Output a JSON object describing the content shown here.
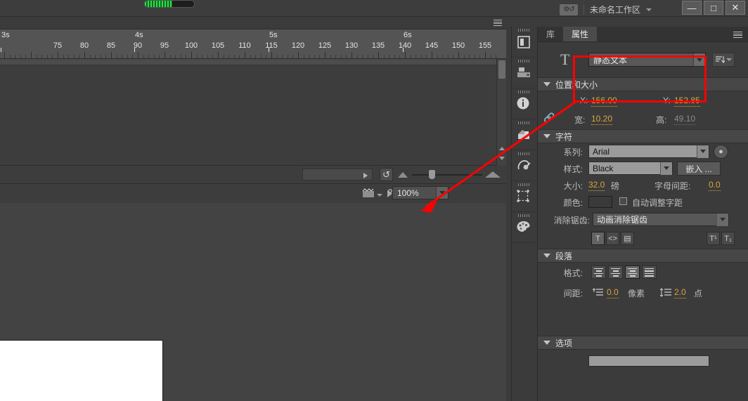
{
  "titlebar": {
    "workspace_name": "未命名工作区",
    "workspace_icon": "workspace-switch-icon",
    "minimize": "—",
    "maximize": "□",
    "close": "✕"
  },
  "timeline": {
    "panel_menu_icon": "panel-menu-icon",
    "second_labels": [
      "3s",
      "4s",
      "5s",
      "6s"
    ],
    "second_positions": [
      0,
      190,
      381,
      572
    ],
    "frame_labels": [
      "75",
      "80",
      "85",
      "90",
      "95",
      "100",
      "105",
      "110",
      "115",
      "120",
      "125",
      "130",
      "135",
      "140",
      "145",
      "150",
      "155"
    ],
    "frame_positions": [
      82,
      120,
      158,
      196,
      234,
      272,
      310,
      348,
      386,
      424,
      462,
      500,
      538,
      576,
      614,
      652,
      690
    ],
    "frame_field_value": "",
    "loop_icon": "loop-icon",
    "onion_small_icon": "onion-skin-small-icon",
    "onion_large_icon": "onion-skin-large-icon"
  },
  "stage_toolbar": {
    "scene_icon": "scene-icon",
    "edit_symbols_icon": "edit-symbols-icon",
    "snap_icon": "snap-to-objects-icon",
    "fit_icon": "fit-in-window-icon",
    "zoom_value": "100%"
  },
  "dock": {
    "items": [
      {
        "name": "library-icon",
        "glyph": "book"
      },
      {
        "name": "align-icon",
        "glyph": "align"
      },
      {
        "name": "info-icon",
        "glyph": "info"
      },
      {
        "name": "color-mixer-icon",
        "glyph": "mixer"
      },
      {
        "name": "swatches-icon",
        "glyph": "swatch"
      },
      {
        "name": "transform-icon",
        "glyph": "transform"
      },
      {
        "name": "color-palette-icon",
        "glyph": "palette"
      }
    ],
    "collapse_icon": "«"
  },
  "properties": {
    "tabs": [
      {
        "label": "库",
        "active": false
      },
      {
        "label": "属性",
        "active": true
      }
    ],
    "panel_menu_icon": "panel-menu-icon",
    "text_tool_glyph": "T",
    "text_type": {
      "value": "静态文本",
      "direction_button_icon": "text-direction-icon"
    },
    "position_size": {
      "title": "位置和大小",
      "x_label": "X:",
      "x_value": "156.00",
      "y_label": "Y:",
      "y_value": "152.85",
      "link_icon": "link-constrain-icon",
      "width_label": "宽:",
      "width_value": "10.20",
      "height_label": "高:",
      "height_value": "49.10"
    },
    "character": {
      "title": "字符",
      "family_label": "系列:",
      "family_value": "Arial",
      "font_preview_icon": "font-preview-icon",
      "style_label": "样式:",
      "style_value": "Black",
      "embed_button": "嵌入 ...",
      "size_label": "大小:",
      "size_value": "32.0",
      "size_unit": "磅",
      "letter_spacing_label": "字母间距:",
      "letter_spacing_value": "0.0",
      "color_label": "颜色:",
      "color_swatch": "#3a3a3a",
      "auto_kern_label": "自动调整字距",
      "auto_kern_checked": false,
      "antialias_label": "消除锯齿:",
      "antialias_value": "动画消除锯齿",
      "toggles": [
        {
          "name": "selectable-text-icon",
          "glyph": "T",
          "on": true
        },
        {
          "name": "render-as-html-icon",
          "glyph": "<>",
          "on": false
        },
        {
          "name": "show-border-icon",
          "glyph": "▤",
          "on": false
        }
      ],
      "script_buttons": [
        {
          "name": "superscript-icon",
          "glyph": "T¹"
        },
        {
          "name": "subscript-icon",
          "glyph": "T₁"
        }
      ]
    },
    "paragraph": {
      "title": "段落",
      "format_label": "格式:",
      "align_buttons": [
        {
          "name": "align-left-icon",
          "on": false
        },
        {
          "name": "align-center-icon",
          "on": false
        },
        {
          "name": "align-right-icon",
          "on": true
        },
        {
          "name": "align-justify-icon",
          "on": false
        }
      ],
      "spacing_label": "间距:",
      "indent_icon": "indent-icon",
      "indent_value": "0.0",
      "indent_unit": "像素",
      "line_spacing_icon": "line-spacing-icon",
      "line_spacing_value": "2.0",
      "line_spacing_unit": "点"
    },
    "options": {
      "title": "选项"
    }
  },
  "annotation": {
    "highlight_color": "#ff0000",
    "box_target": "text-type-dropdown",
    "arrow_target": "position-size-section"
  }
}
